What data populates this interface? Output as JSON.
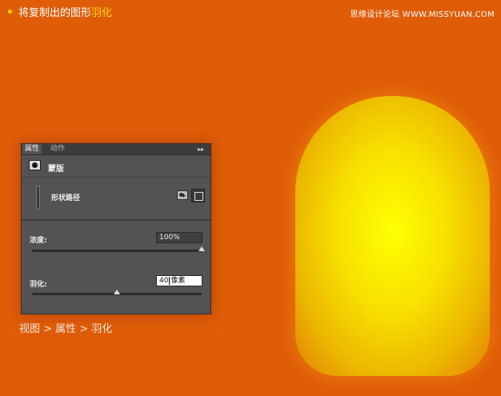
{
  "header": {
    "instruction_prefix": "将复制出的图形",
    "instruction_highlight": "羽化",
    "watermark": "思缘设计论坛 WWW.MISSYUAN.COM"
  },
  "panel": {
    "tabs": [
      {
        "label": "属性",
        "active": true
      },
      {
        "label": "动作",
        "active": false
      }
    ],
    "menu_icon": "▸▸",
    "mask_title": "蒙版",
    "path_label": "形状路径",
    "density": {
      "label": "浓度:",
      "value": "100%",
      "slider_fraction": 1.0
    },
    "feather": {
      "label": "羽化:",
      "value": "40",
      "unit": "像素",
      "slider_fraction": 0.5
    }
  },
  "breadcrumb": "视图 > 属性 > 羽化",
  "colors": {
    "background": "#e05d08",
    "highlight": "#ffd400",
    "shape_center": "#ffff00",
    "shape_edge": "#e27e06"
  },
  "icons": {
    "mask": "mask-icon",
    "add_mask": "add-pixel-mask-icon",
    "select_path": "select-vector-mask-icon",
    "panel_menu": "panel-menu-icon"
  }
}
